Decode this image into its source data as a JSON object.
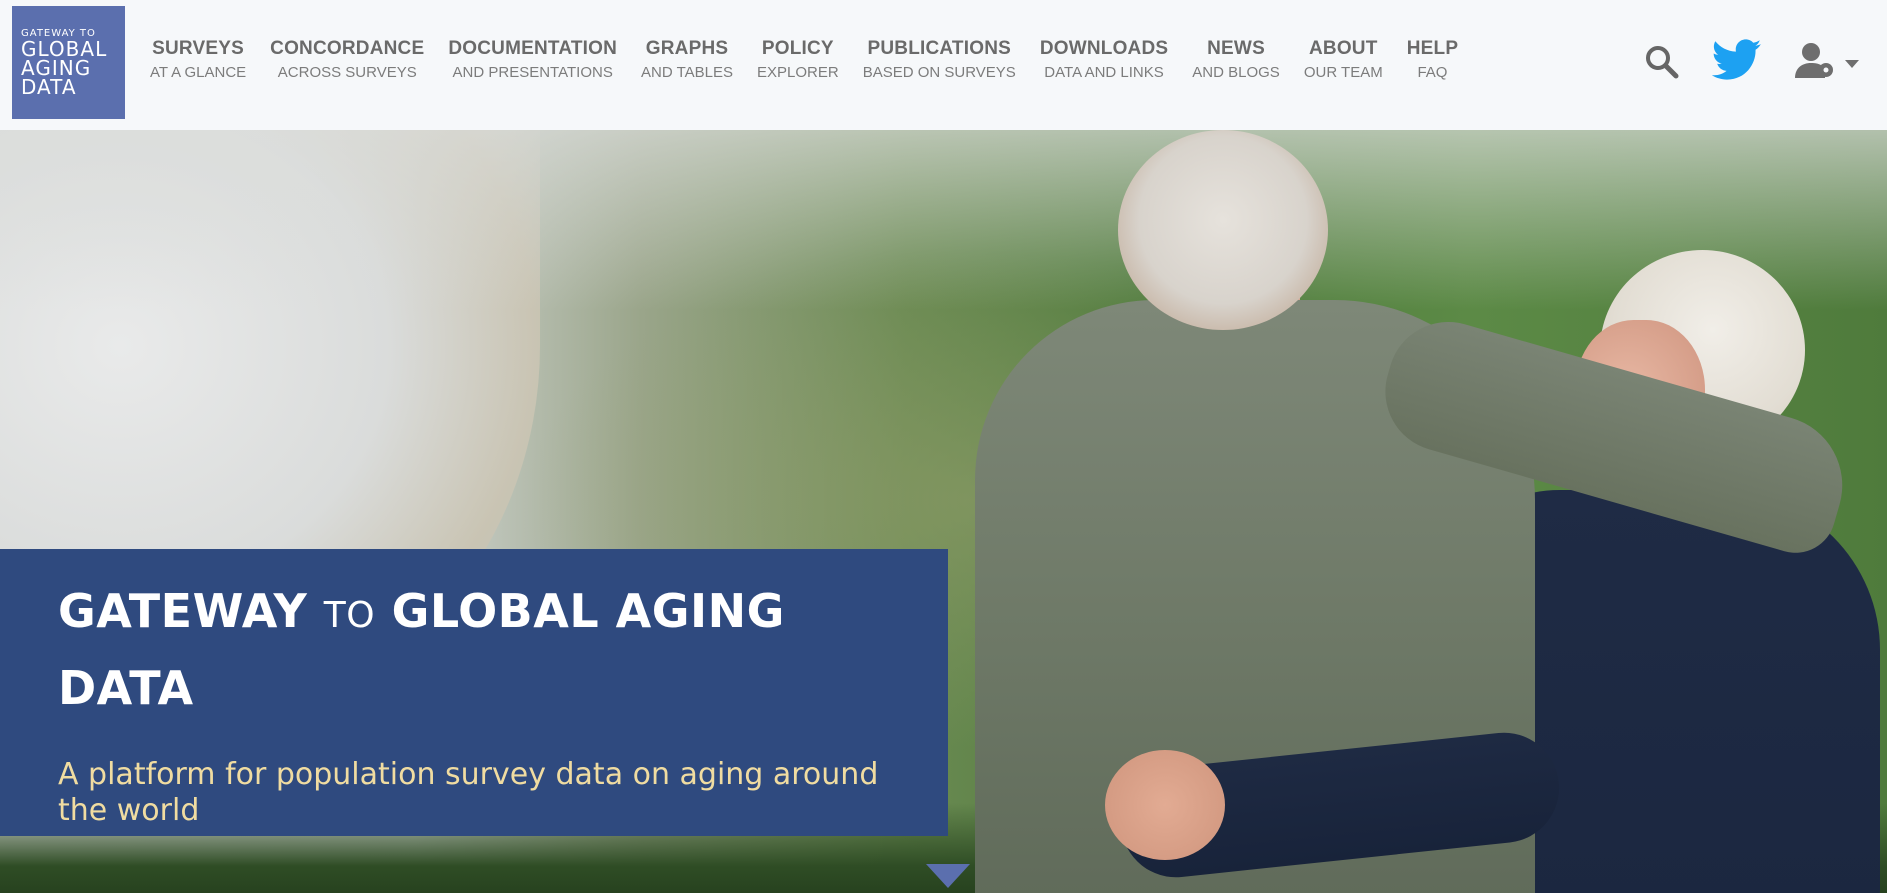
{
  "header": {
    "logo": {
      "line_small": "GATEWAY TO",
      "line1": "GLOBAL",
      "line2": "AGING",
      "line3": "DATA"
    },
    "nav": [
      {
        "label": "SURVEYS",
        "sub": "AT A GLANCE"
      },
      {
        "label": "CONCORDANCE",
        "sub": "ACROSS SURVEYS"
      },
      {
        "label": "DOCUMENTATION",
        "sub": "AND PRESENTATIONS"
      },
      {
        "label": "GRAPHS",
        "sub": "AND TABLES"
      },
      {
        "label": "POLICY",
        "sub": "EXPLORER"
      },
      {
        "label": "PUBLICATIONS",
        "sub": "BASED ON SURVEYS"
      },
      {
        "label": "DOWNLOADS",
        "sub": "DATA AND LINKS"
      },
      {
        "label": "NEWS",
        "sub": "AND BLOGS"
      },
      {
        "label": "ABOUT",
        "sub": "OUR TEAM"
      },
      {
        "label": "HELP",
        "sub": "FAQ"
      }
    ],
    "icons": {
      "search": "search-icon",
      "twitter": "twitter-icon",
      "user": "user-settings-icon"
    }
  },
  "hero": {
    "title_part1": "GATEWAY",
    "title_to": "TO",
    "title_part2": "GLOBAL AGING",
    "title_part3": "DATA",
    "tagline": "A platform for population survey data on aging around the world"
  },
  "colors": {
    "logo_bg": "#5b6fae",
    "banner_bg": "#2f4a7f",
    "tagline": "#f0dca1",
    "twitter": "#1da1f2",
    "nav_text": "#6a6a6a"
  }
}
